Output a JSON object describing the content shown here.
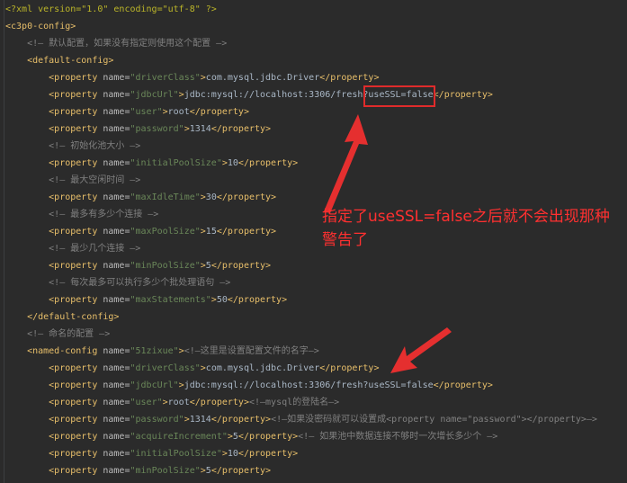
{
  "editor": {
    "lines": [
      [
        {
          "c": "decl",
          "t": "<?xml version=\"1.0\" encoding=\"utf-8\" ?>"
        }
      ],
      [
        {
          "c": "tag",
          "t": "<c3p0-config>"
        }
      ],
      [
        {
          "c": "cmt",
          "t": "    <!— 默认配置，如果没有指定则使用这个配置 —>"
        }
      ],
      [
        {
          "c": "tag",
          "t": "    <default-config>"
        }
      ],
      [
        {
          "c": "tag",
          "t": "        <property "
        },
        {
          "c": "attr",
          "t": "name="
        },
        {
          "c": "val",
          "t": "\"driverClass\""
        },
        {
          "c": "tag",
          "t": ">"
        },
        {
          "c": "txt",
          "t": "com.mysql.jdbc.Driver"
        },
        {
          "c": "tag",
          "t": "</property>"
        }
      ],
      [
        {
          "c": "tag",
          "t": "        <property "
        },
        {
          "c": "attr",
          "t": "name="
        },
        {
          "c": "val",
          "t": "\"jdbcUrl\""
        },
        {
          "c": "tag",
          "t": ">"
        },
        {
          "c": "txt",
          "t": "jdbc:mysql://localhost:3306/fresh?useSSL=false"
        },
        {
          "c": "tag",
          "t": "</property>"
        }
      ],
      [
        {
          "c": "tag",
          "t": "        <property "
        },
        {
          "c": "attr",
          "t": "name="
        },
        {
          "c": "val",
          "t": "\"user\""
        },
        {
          "c": "tag",
          "t": ">"
        },
        {
          "c": "txt",
          "t": "root"
        },
        {
          "c": "tag",
          "t": "</property>"
        }
      ],
      [
        {
          "c": "tag",
          "t": "        <property "
        },
        {
          "c": "attr",
          "t": "name="
        },
        {
          "c": "val",
          "t": "\"password\""
        },
        {
          "c": "tag",
          "t": ">"
        },
        {
          "c": "txt",
          "t": "1314"
        },
        {
          "c": "tag",
          "t": "</property>"
        }
      ],
      [
        {
          "c": "cmt",
          "t": "        <!— 初始化池大小 —>"
        }
      ],
      [
        {
          "c": "tag",
          "t": "        <property "
        },
        {
          "c": "attr",
          "t": "name="
        },
        {
          "c": "val",
          "t": "\"initialPoolSize\""
        },
        {
          "c": "tag",
          "t": ">"
        },
        {
          "c": "txt",
          "t": "10"
        },
        {
          "c": "tag",
          "t": "</property>"
        }
      ],
      [
        {
          "c": "cmt",
          "t": "        <!— 最大空闲时间 —>"
        }
      ],
      [
        {
          "c": "tag",
          "t": "        <property "
        },
        {
          "c": "attr",
          "t": "name="
        },
        {
          "c": "val",
          "t": "\"maxIdleTime\""
        },
        {
          "c": "tag",
          "t": ">"
        },
        {
          "c": "txt",
          "t": "30"
        },
        {
          "c": "tag",
          "t": "</property>"
        }
      ],
      [
        {
          "c": "cmt",
          "t": "        <!— 最多有多少个连接 —>"
        }
      ],
      [
        {
          "c": "tag",
          "t": "        <property "
        },
        {
          "c": "attr",
          "t": "name="
        },
        {
          "c": "val",
          "t": "\"maxPoolSize\""
        },
        {
          "c": "tag",
          "t": ">"
        },
        {
          "c": "txt",
          "t": "15"
        },
        {
          "c": "tag",
          "t": "</property>"
        }
      ],
      [
        {
          "c": "cmt",
          "t": "        <!— 最少几个连接 —>"
        }
      ],
      [
        {
          "c": "tag",
          "t": "        <property "
        },
        {
          "c": "attr",
          "t": "name="
        },
        {
          "c": "val",
          "t": "\"minPoolSize\""
        },
        {
          "c": "tag",
          "t": ">"
        },
        {
          "c": "txt",
          "t": "5"
        },
        {
          "c": "tag",
          "t": "</property>"
        }
      ],
      [
        {
          "c": "cmt",
          "t": "        <!— 每次最多可以执行多少个批处理语句 —>"
        }
      ],
      [
        {
          "c": "tag",
          "t": "        <property "
        },
        {
          "c": "attr",
          "t": "name="
        },
        {
          "c": "val",
          "t": "\"maxStatements\""
        },
        {
          "c": "tag",
          "t": ">"
        },
        {
          "c": "txt",
          "t": "50"
        },
        {
          "c": "tag",
          "t": "</property>"
        }
      ],
      [
        {
          "c": "tag",
          "t": "    </default-config>"
        }
      ],
      [
        {
          "c": "cmt",
          "t": "    <!— 命名的配置 —>"
        }
      ],
      [
        {
          "c": "tag",
          "t": "    <named-config "
        },
        {
          "c": "attr",
          "t": "name="
        },
        {
          "c": "val",
          "t": "\"51zixue\""
        },
        {
          "c": "tag",
          "t": ">"
        },
        {
          "c": "cmt",
          "t": "<!—这里是设置配置文件的名字—>"
        }
      ],
      [
        {
          "c": "tag",
          "t": "        <property "
        },
        {
          "c": "attr",
          "t": "name="
        },
        {
          "c": "val",
          "t": "\"driverClass\""
        },
        {
          "c": "tag",
          "t": ">"
        },
        {
          "c": "txt",
          "t": "com.mysql.jdbc.Driver"
        },
        {
          "c": "tag",
          "t": "</property>"
        }
      ],
      [
        {
          "c": "tag",
          "t": "        <property "
        },
        {
          "c": "attr",
          "t": "name="
        },
        {
          "c": "val",
          "t": "\"jdbcUrl\""
        },
        {
          "c": "tag",
          "t": ">"
        },
        {
          "c": "txt",
          "t": "jdbc:mysql://localhost:3306/fresh?useSSL=false"
        },
        {
          "c": "tag",
          "t": "</property>"
        }
      ],
      [
        {
          "c": "tag",
          "t": "        <property "
        },
        {
          "c": "attr",
          "t": "name="
        },
        {
          "c": "val",
          "t": "\"user\""
        },
        {
          "c": "tag",
          "t": ">"
        },
        {
          "c": "txt",
          "t": "root"
        },
        {
          "c": "tag",
          "t": "</property>"
        },
        {
          "c": "cmt",
          "t": "<!—mysql的登陆名—>"
        }
      ],
      [
        {
          "c": "tag",
          "t": "        <property "
        },
        {
          "c": "attr",
          "t": "name="
        },
        {
          "c": "val",
          "t": "\"password\""
        },
        {
          "c": "tag",
          "t": ">"
        },
        {
          "c": "txt",
          "t": "1314"
        },
        {
          "c": "tag",
          "t": "</property>"
        },
        {
          "c": "cmt",
          "t": "<!—如果没密码就可以设置成<property name=\"password\"></property>—>"
        }
      ],
      [
        {
          "c": "tag",
          "t": "        <property "
        },
        {
          "c": "attr",
          "t": "name="
        },
        {
          "c": "val",
          "t": "\"acquireIncrement\""
        },
        {
          "c": "tag",
          "t": ">"
        },
        {
          "c": "txt",
          "t": "5"
        },
        {
          "c": "tag",
          "t": "</property>"
        },
        {
          "c": "cmt",
          "t": "<!— 如果池中数据连接不够时一次增长多少个 —>"
        }
      ],
      [
        {
          "c": "tag",
          "t": "        <property "
        },
        {
          "c": "attr",
          "t": "name="
        },
        {
          "c": "val",
          "t": "\"initialPoolSize\""
        },
        {
          "c": "tag",
          "t": ">"
        },
        {
          "c": "txt",
          "t": "10"
        },
        {
          "c": "tag",
          "t": "</property>"
        }
      ],
      [
        {
          "c": "tag",
          "t": "        <property "
        },
        {
          "c": "attr",
          "t": "name="
        },
        {
          "c": "val",
          "t": "\"minPoolSize\""
        },
        {
          "c": "tag",
          "t": ">"
        },
        {
          "c": "txt",
          "t": "5"
        },
        {
          "c": "tag",
          "t": "</property>"
        }
      ]
    ]
  },
  "annotation": {
    "text": "指定了useSSL=false之后就不会出现那种警告了",
    "color": "#ff3030"
  },
  "colors": {
    "background": "#2b2b2b",
    "tag": "#e8bf6a",
    "attribute": "#bababa",
    "attribute_value": "#6a8759",
    "comment": "#808080",
    "text": "#a9b7c6",
    "highlight_box": "#e02b2b"
  }
}
